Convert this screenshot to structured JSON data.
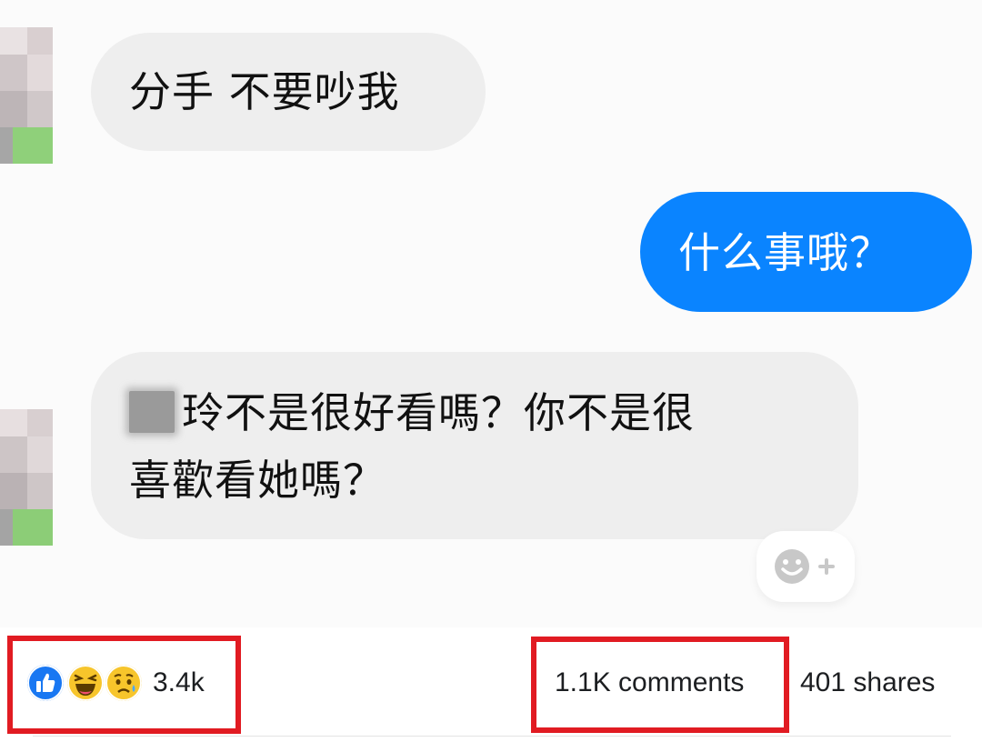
{
  "messages": [
    {
      "direction": "incoming",
      "text": "分手 不要吵我"
    },
    {
      "direction": "outgoing",
      "text": "什么事哦？"
    },
    {
      "direction": "incoming",
      "line1": "玲不是很好看嗎？你不是很",
      "line2": "喜歡看她嗎？"
    }
  ],
  "reactions": {
    "emojis": [
      "like-icon",
      "haha-icon",
      "sad-icon"
    ],
    "count": "3.4k"
  },
  "stats": {
    "comments": "1.1K comments",
    "shares": "401 shares"
  },
  "colors": {
    "outgoing_bubble": "#0a84ff",
    "incoming_bubble": "#eeeeee",
    "highlight_box": "#e11b22"
  }
}
